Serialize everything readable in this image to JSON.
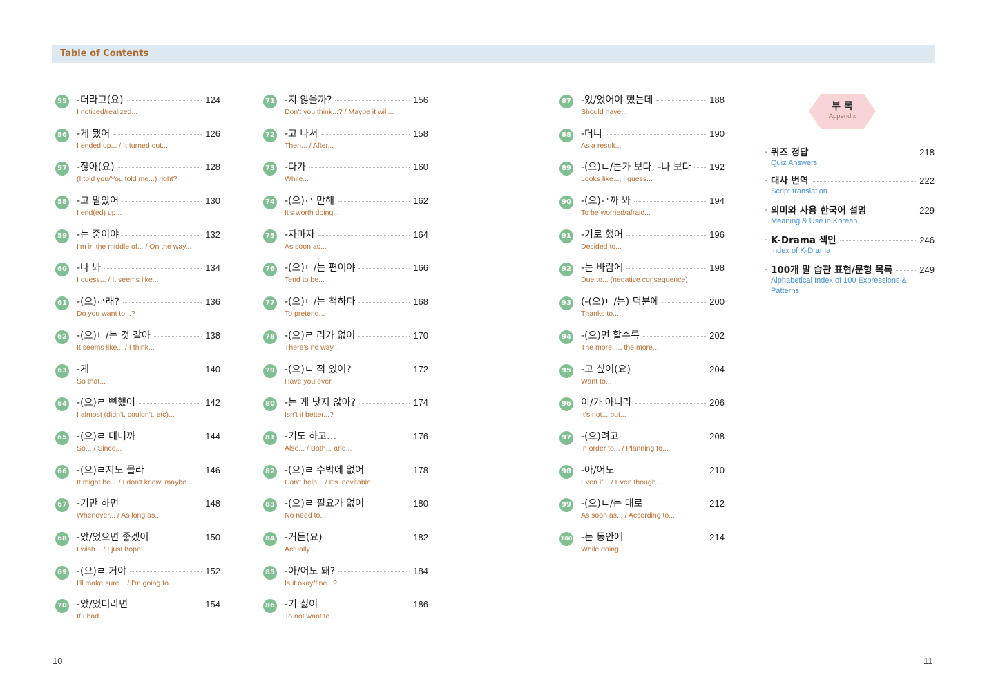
{
  "header": {
    "title": "Table of Contents"
  },
  "columns": [
    [
      {
        "num": "55",
        "ko": "-더라고(요)",
        "page": "124",
        "en": "I noticed/realized..."
      },
      {
        "num": "56",
        "ko": "-게 됐어",
        "page": "126",
        "en": "I ended up... / It turned out..."
      },
      {
        "num": "57",
        "ko": "-잖아(요)",
        "page": "128",
        "en": "(I told you/You told me...) right?"
      },
      {
        "num": "58",
        "ko": "-고 말았어",
        "page": "130",
        "en": "I end(ed) up..."
      },
      {
        "num": "59",
        "ko": "-는 중이야",
        "page": "132",
        "en": "I'm in the middle of... / On the way..."
      },
      {
        "num": "60",
        "ko": "-나 봐",
        "page": "134",
        "en": "I guess... / It seems like..."
      },
      {
        "num": "61",
        "ko": "-(으)ㄹ래?",
        "page": "136",
        "en": "Do you want to...?"
      },
      {
        "num": "62",
        "ko": "-(으)ㄴ/는 것 같아",
        "page": "138",
        "en": "It seems like... / I think..."
      },
      {
        "num": "63",
        "ko": "-게",
        "page": "140",
        "en": "So that..."
      },
      {
        "num": "64",
        "ko": "-(으)ㄹ 뻔했어",
        "page": "142",
        "en": "I almost (didn't, couldn't, etc)..."
      },
      {
        "num": "65",
        "ko": "-(으)ㄹ 테니까",
        "page": "144",
        "en": "So... / Since..."
      },
      {
        "num": "66",
        "ko": "-(으)ㄹ지도 몰라",
        "page": "146",
        "en": "It might be... / I don't know, maybe..."
      },
      {
        "num": "67",
        "ko": "-기만 하면",
        "page": "148",
        "en": "Whenever... / As long as..."
      },
      {
        "num": "68",
        "ko": "-았/었으면 좋겠어",
        "page": "150",
        "en": "I wish... / I just hope..."
      },
      {
        "num": "69",
        "ko": "-(으)ㄹ 거야",
        "page": "152",
        "en": "I'll make sure... / I'm going to..."
      },
      {
        "num": "70",
        "ko": "-았/었더라면",
        "page": "154",
        "en": "If I had..."
      }
    ],
    [
      {
        "num": "71",
        "ko": "-지 않을까?",
        "page": "156",
        "en": "Don't you think...? / Maybe it will..."
      },
      {
        "num": "72",
        "ko": "-고 나서",
        "page": "158",
        "en": "Then... / After..."
      },
      {
        "num": "73",
        "ko": "-다가",
        "page": "160",
        "en": "While..."
      },
      {
        "num": "74",
        "ko": "-(으)ㄹ 만해",
        "page": "162",
        "en": "It's worth doing..."
      },
      {
        "num": "75",
        "ko": "-자마자",
        "page": "164",
        "en": "As soon as..."
      },
      {
        "num": "76",
        "ko": "-(으)ㄴ/는 편이야",
        "page": "166",
        "en": "Tend to be..."
      },
      {
        "num": "77",
        "ko": "-(으)ㄴ/는 척하다",
        "page": "168",
        "en": "To pretend..."
      },
      {
        "num": "78",
        "ko": "-(으)ㄹ 리가 없어",
        "page": "170",
        "en": "There's no way..."
      },
      {
        "num": "79",
        "ko": "-(으)ㄴ 적 있어?",
        "page": "172",
        "en": "Have you ever..."
      },
      {
        "num": "80",
        "ko": "-는 게 낫지 않아?",
        "page": "174",
        "en": "Isn't it better...?"
      },
      {
        "num": "81",
        "ko": "-기도 하고…",
        "page": "176",
        "en": "Also... / Both... and..."
      },
      {
        "num": "82",
        "ko": "-(으)ㄹ 수밖에 없어",
        "page": "178",
        "en": "Can't help... / It's inevitable..."
      },
      {
        "num": "83",
        "ko": "-(으)ㄹ 필요가 없어",
        "page": "180",
        "en": "No need to..."
      },
      {
        "num": "84",
        "ko": "-거든(요)",
        "page": "182",
        "en": "Actually..."
      },
      {
        "num": "85",
        "ko": "-아/어도 돼?",
        "page": "184",
        "en": "Is it okay/fine...?"
      },
      {
        "num": "86",
        "ko": "-기 싫어",
        "page": "186",
        "en": "To not want to..."
      }
    ],
    [
      {
        "num": "87",
        "ko": "-았/었어야 했는데",
        "page": "188",
        "en": "Should have..."
      },
      {
        "num": "88",
        "ko": "-더니",
        "page": "190",
        "en": "As a result..."
      },
      {
        "num": "89",
        "ko": "-(으)ㄴ/는가 보다, -나 보다",
        "page": "192",
        "en": "Looks like..., I guess..."
      },
      {
        "num": "90",
        "ko": "-(으)ㄹ까 봐",
        "page": "194",
        "en": "To be worried/afraid..."
      },
      {
        "num": "91",
        "ko": "-기로 했어",
        "page": "196",
        "en": "Decided to..."
      },
      {
        "num": "92",
        "ko": "-는 바람에",
        "page": "198",
        "en": "Due to... (negative consequence)"
      },
      {
        "num": "93",
        "ko": "(-(으)ㄴ/는) 덕분에",
        "page": "200",
        "en": "Thanks to..."
      },
      {
        "num": "94",
        "ko": "-(으)면 할수록",
        "page": "202",
        "en": "The more ..., the more..."
      },
      {
        "num": "95",
        "ko": "-고 싶어(요)",
        "page": "204",
        "en": "Want to..."
      },
      {
        "num": "96",
        "ko": "이/가 아니라",
        "page": "206",
        "en": "It's not... but..."
      },
      {
        "num": "97",
        "ko": "-(으)려고",
        "page": "208",
        "en": "In order to... / Planning to..."
      },
      {
        "num": "98",
        "ko": "-아/어도",
        "page": "210",
        "en": "Even if... / Even though..."
      },
      {
        "num": "99",
        "ko": "-(으)ㄴ/는 대로",
        "page": "212",
        "en": "As soon as... / According to..."
      },
      {
        "num": "100",
        "ko": "-는 동안에",
        "page": "214",
        "en": "While doing..."
      }
    ]
  ],
  "appendix": {
    "title_ko": "부 록",
    "title_en": "Appendix",
    "items": [
      {
        "ko": "퀴즈 정답",
        "page": "218",
        "en": "Quiz Answers"
      },
      {
        "ko": "대사 번역",
        "page": "222",
        "en": "Script translation"
      },
      {
        "ko": "의미와 사용 한국어 설명",
        "page": "229",
        "en": "Meaning & Use in Korean"
      },
      {
        "ko": "K-Drama 색인",
        "page": "246",
        "en": "Index of K-Drama"
      },
      {
        "ko": "100개 말 습관 표현/문형 목록",
        "page": "249",
        "en": "Alphabetical Index of 100 Expressions & Patterns"
      }
    ]
  },
  "page_numbers": {
    "left": "10",
    "right": "11"
  }
}
